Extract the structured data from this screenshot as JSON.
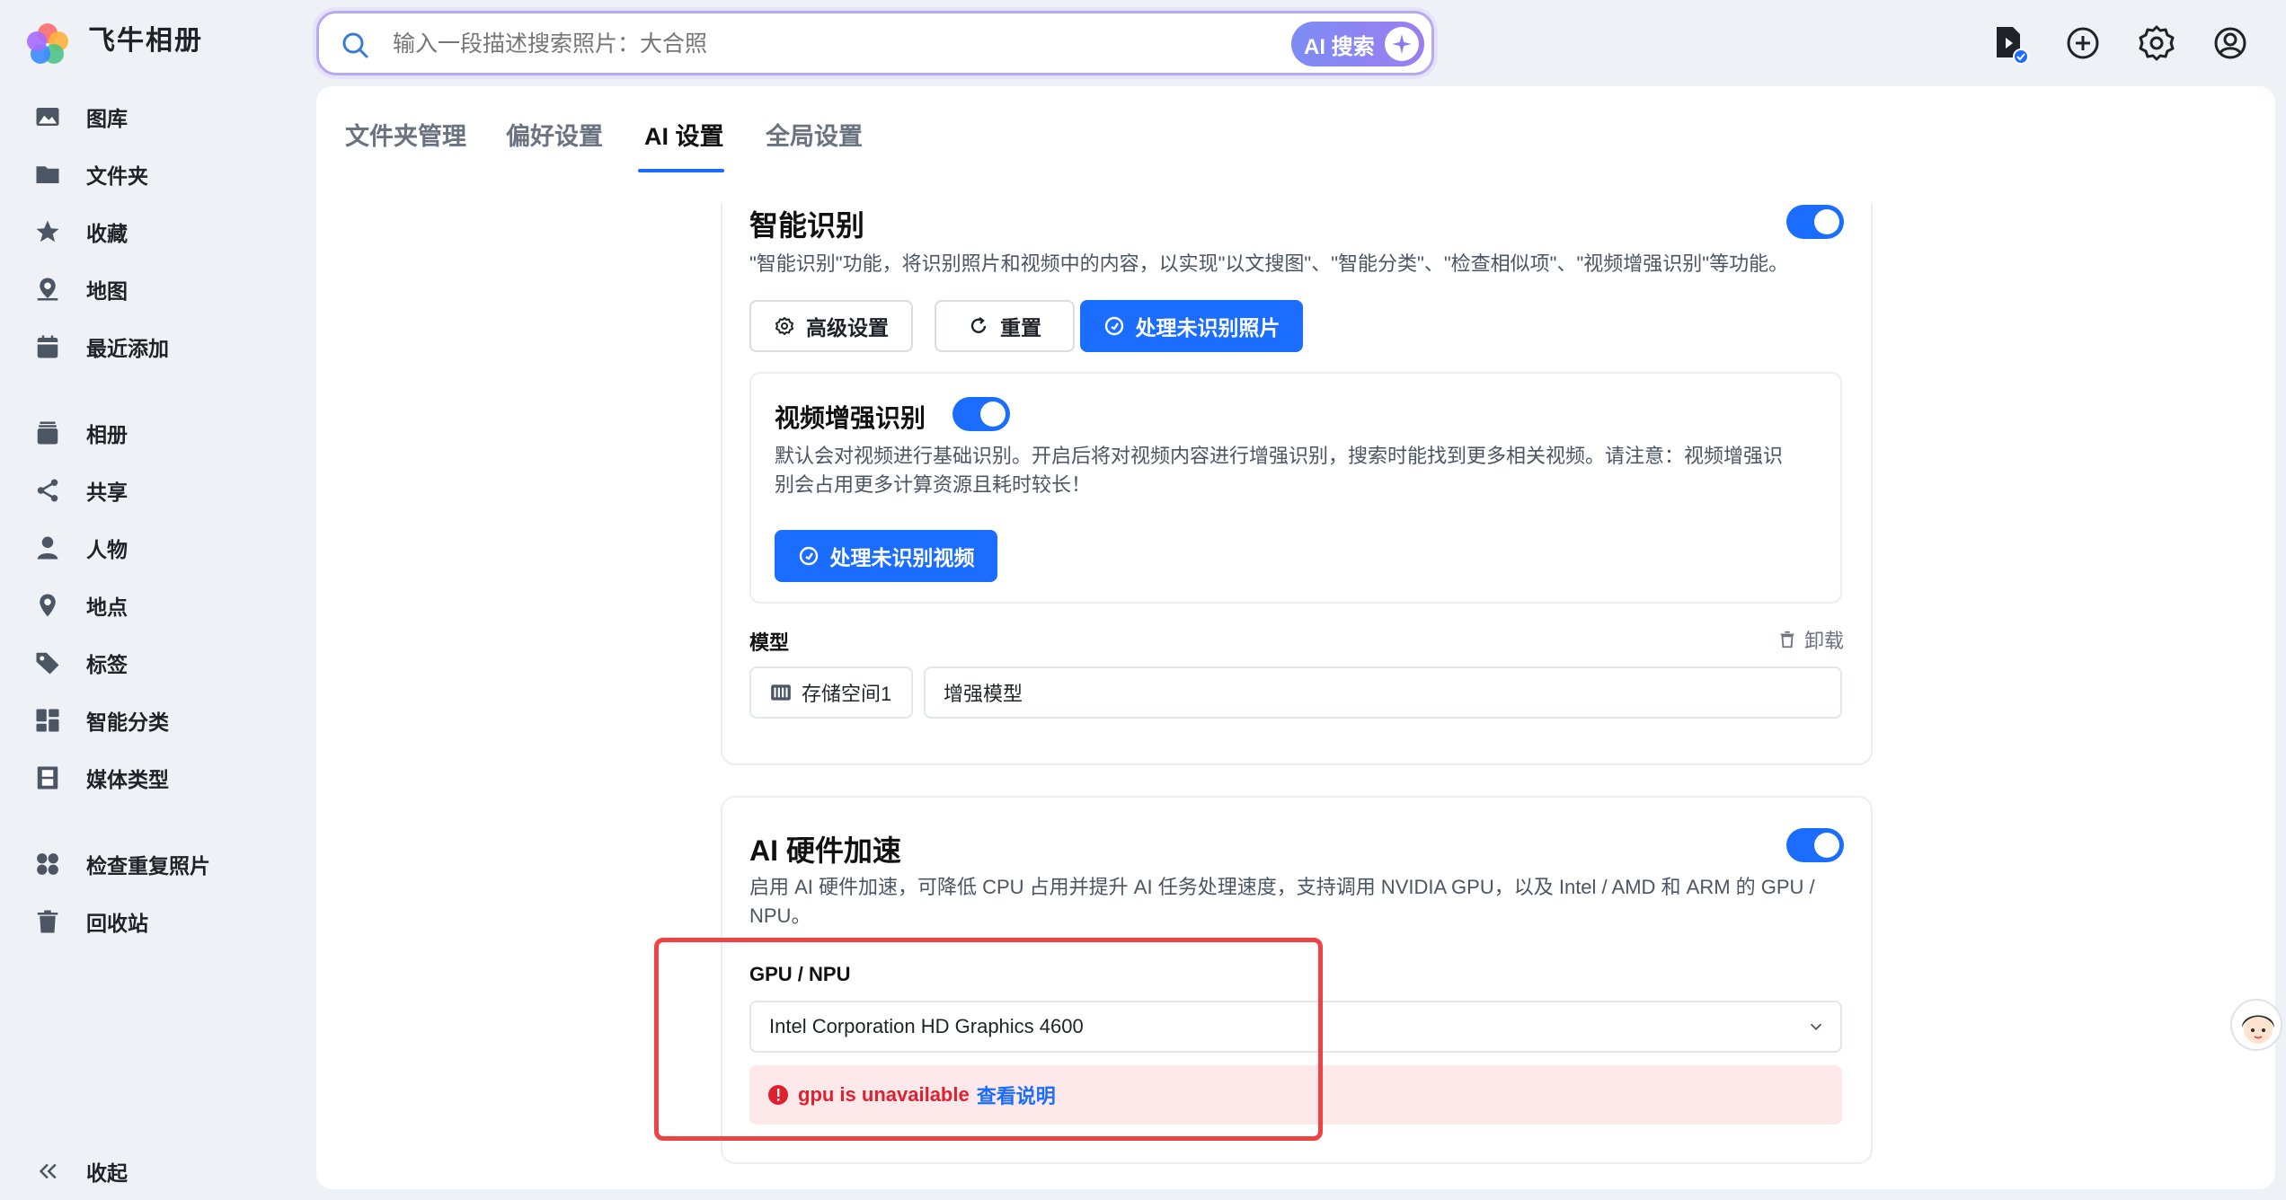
{
  "app": {
    "title": "飞牛相册"
  },
  "search": {
    "placeholder": "输入一段描述搜索照片：大合照",
    "ai_button": "AI 搜索"
  },
  "sidebar": {
    "items": [
      {
        "label": "图库",
        "icon": "gallery-icon"
      },
      {
        "label": "文件夹",
        "icon": "folder-icon"
      },
      {
        "label": "收藏",
        "icon": "star-icon"
      },
      {
        "label": "地图",
        "icon": "map-icon"
      },
      {
        "label": "最近添加",
        "icon": "calendar-icon"
      },
      {
        "label": "相册",
        "icon": "album-icon"
      },
      {
        "label": "共享",
        "icon": "share-icon"
      },
      {
        "label": "人物",
        "icon": "person-icon"
      },
      {
        "label": "地点",
        "icon": "location-icon"
      },
      {
        "label": "标签",
        "icon": "tag-icon"
      },
      {
        "label": "智能分类",
        "icon": "grid-icon"
      },
      {
        "label": "媒体类型",
        "icon": "film-icon"
      },
      {
        "label": "检查重复照片",
        "icon": "duplicate-icon"
      },
      {
        "label": "回收站",
        "icon": "trash-icon"
      }
    ],
    "collapse": "收起"
  },
  "tabs": [
    "文件夹管理",
    "偏好设置",
    "AI 设置",
    "全局设置"
  ],
  "active_tab": "AI 设置",
  "smart_recognition": {
    "title": "智能识别",
    "description": "\"智能识别\"功能，将识别照片和视频中的内容，以实现\"以文搜图\"、\"智能分类\"、\"检查相似项\"、\"视频增强识别\"等功能。",
    "buttons": {
      "advanced": "高级设置",
      "reset": "重置",
      "process_photos": "处理未识别照片"
    },
    "enabled": true
  },
  "video_enhanced": {
    "title": "视频增强识别",
    "description_line1": "默认会对视频进行基础识别。开启后将对视频内容进行增强识别，搜索时能找到更多相关视频。请注意：视频增强识",
    "description_line2": "别会占用更多计算资源且耗时较长！",
    "button": "处理未识别视频",
    "enabled": true
  },
  "model": {
    "label": "模型",
    "uninstall": "卸载",
    "storage": "存储空间1",
    "model_name": "增强模型"
  },
  "hardware_accel": {
    "title": "AI 硬件加速",
    "description_line1": "启用 AI 硬件加速，可降低 CPU 占用并提升 AI 任务处理速度，支持调用 NVIDIA GPU，以及 Intel / AMD 和 ARM 的 GPU /",
    "description_line2": "NPU。",
    "enabled": true,
    "gpu_label": "GPU / NPU",
    "gpu_selected": "Intel Corporation HD Graphics 4600",
    "error": "gpu is unavailable",
    "error_link": "查看说明"
  },
  "colors": {
    "accent": "#1a6dff",
    "error": "#e0202f",
    "highlight": "#ef4242"
  }
}
